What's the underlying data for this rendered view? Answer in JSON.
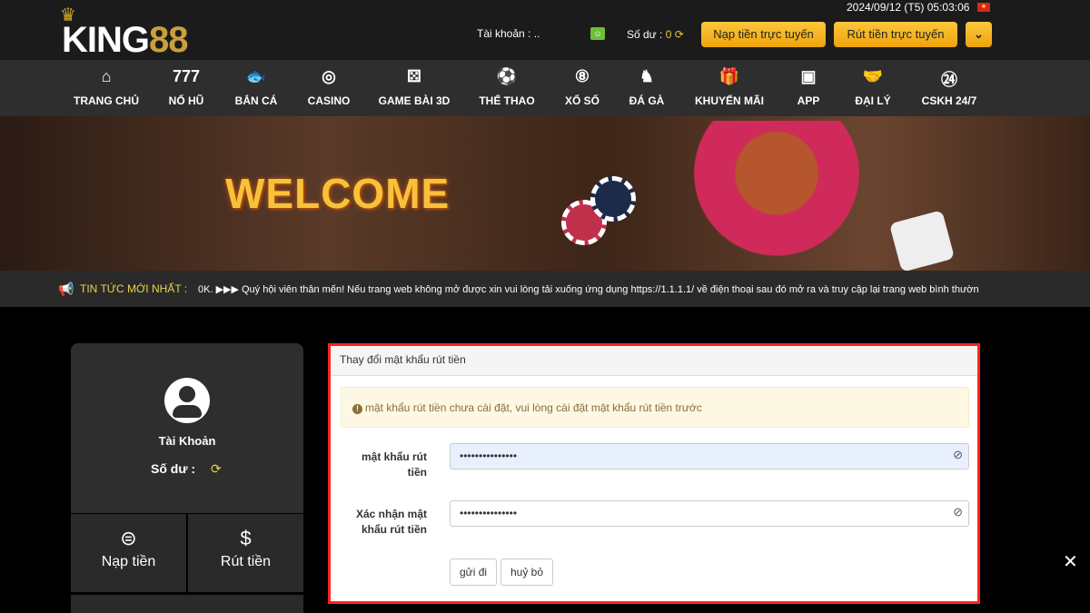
{
  "header": {
    "logo": "KING88",
    "datetime": "2024/09/12 (T5) 05:03:06",
    "account_label": "Tài khoản : ..",
    "balance_label": "Số dư :",
    "balance_value": "0",
    "deposit_button": "Nạp tiền trực tuyến",
    "withdraw_button": "Rút tiền trực tuyến"
  },
  "nav": [
    {
      "label": "TRANG CHỦ",
      "icon": "home-icon",
      "glyph": "⌂"
    },
    {
      "label": "NỔ HŨ",
      "icon": "slot-icon",
      "glyph": "777"
    },
    {
      "label": "BẮN CÁ",
      "icon": "fish-icon",
      "glyph": "🐟"
    },
    {
      "label": "CASINO",
      "icon": "roulette-icon",
      "glyph": "◎"
    },
    {
      "label": "GAME BÀI 3D",
      "icon": "dice-icon",
      "glyph": "⚄"
    },
    {
      "label": "THỂ THAO",
      "icon": "soccer-icon",
      "glyph": "⚽"
    },
    {
      "label": "XỔ SỐ",
      "icon": "lottery-icon",
      "glyph": "⑧"
    },
    {
      "label": "ĐÁ GÀ",
      "icon": "rooster-icon",
      "glyph": "♞"
    },
    {
      "label": "KHUYẾN MÃI",
      "icon": "gift-icon",
      "glyph": "🎁"
    },
    {
      "label": "APP",
      "icon": "app-icon",
      "glyph": "▣"
    },
    {
      "label": "ĐẠI LÝ",
      "icon": "handshake-icon",
      "glyph": "🤝"
    },
    {
      "label": "CSKH 24/7",
      "icon": "support-icon",
      "glyph": "㉔"
    }
  ],
  "banner": {
    "title": "WELCOME"
  },
  "news": {
    "label": "TIN TỨC MỚI NHẤT :",
    "text": "0K.   ▶▶▶ Quý hội viên thân mến! Nếu trang web không mở được xin vui lòng tải xuống ứng dụng https://1.1.1.1/ về điện thoại sau đó mở ra và truy cập lại trang web bình thường, xin"
  },
  "sidebar": {
    "account_label": "Tài Khoản",
    "balance_label": "Số dư :",
    "deposit": "Nạp tiền",
    "withdraw": "Rút tiền"
  },
  "panel": {
    "title": "Thay đổi mật khẩu rút tiền",
    "alert": "mật khẩu rút tiền chưa cài đặt, vui lòng cài đặt mật khẩu rút tiền trước",
    "field1_label": "mật khẩu rút tiền",
    "field1_value": "•••••••••••••••",
    "field2_label": "Xác nhận mật khẩu rút tiền",
    "field2_value": "•••••••••••••••",
    "submit": "gửi đi",
    "cancel": "huỷ bỏ"
  },
  "colors": {
    "accent": "#f4b41a",
    "highlight_border": "#ff2222",
    "autofill": "#e8f0fe"
  }
}
